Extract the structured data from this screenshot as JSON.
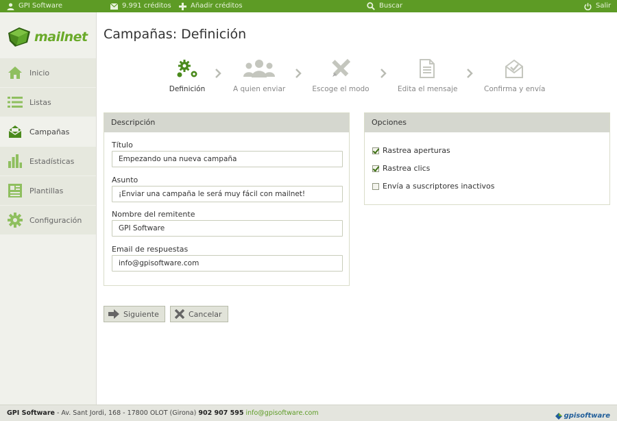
{
  "topbar": {
    "user": "GPI Software",
    "credits": "9.991 créditos",
    "add_credits": "Añadir créditos",
    "search": "Buscar",
    "logout": "Salir"
  },
  "logo": {
    "text": "mailnet"
  },
  "sidebar": {
    "items": [
      {
        "label": "Inicio",
        "icon": "home-icon"
      },
      {
        "label": "Listas",
        "icon": "list-icon"
      },
      {
        "label": "Campañas",
        "icon": "envelope-icon",
        "active": true
      },
      {
        "label": "Estadísticas",
        "icon": "bar-chart-icon"
      },
      {
        "label": "Plantillas",
        "icon": "template-icon"
      },
      {
        "label": "Configuración",
        "icon": "gear-icon"
      }
    ]
  },
  "page": {
    "title": "Campañas: Definición"
  },
  "steps": [
    {
      "label": "Definición",
      "icon": "gears-icon",
      "active": true
    },
    {
      "label": "A quien enviar",
      "icon": "users-icon"
    },
    {
      "label": "Escoge el modo",
      "icon": "pencil-ruler-icon"
    },
    {
      "label": "Edita el mensaje",
      "icon": "document-icon"
    },
    {
      "label": "Confirma y envía",
      "icon": "open-envelope-icon"
    }
  ],
  "description": {
    "title": "Descripción",
    "fields": [
      {
        "label": "Título",
        "value": "Empezando una nueva campaña"
      },
      {
        "label": "Asunto",
        "value": "¡Enviar una campaña le será muy fácil con mailnet!"
      },
      {
        "label": "Nombre del remitente",
        "value": "GPI Software"
      },
      {
        "label": "Email de respuestas",
        "value": "info@gpisoftware.com"
      }
    ]
  },
  "options": {
    "title": "Opciones",
    "items": [
      {
        "label": "Rastrea aperturas",
        "checked": true
      },
      {
        "label": "Rastrea clics",
        "checked": true
      },
      {
        "label": "Envía a suscriptores inactivos",
        "checked": false
      }
    ]
  },
  "buttons": {
    "next": "Siguiente",
    "cancel": "Cancelar"
  },
  "footer": {
    "company": "GPI Software",
    "address": " - Av. Sant Jordi, 168 - 17800 OLOT (Girona) ",
    "phone": "902 907 595",
    "email": "info@gpisoftware.com",
    "logo_text": "gpisoftware"
  },
  "colors": {
    "brand_green": "#5d9b25",
    "accent_green": "#6aaa2a"
  }
}
